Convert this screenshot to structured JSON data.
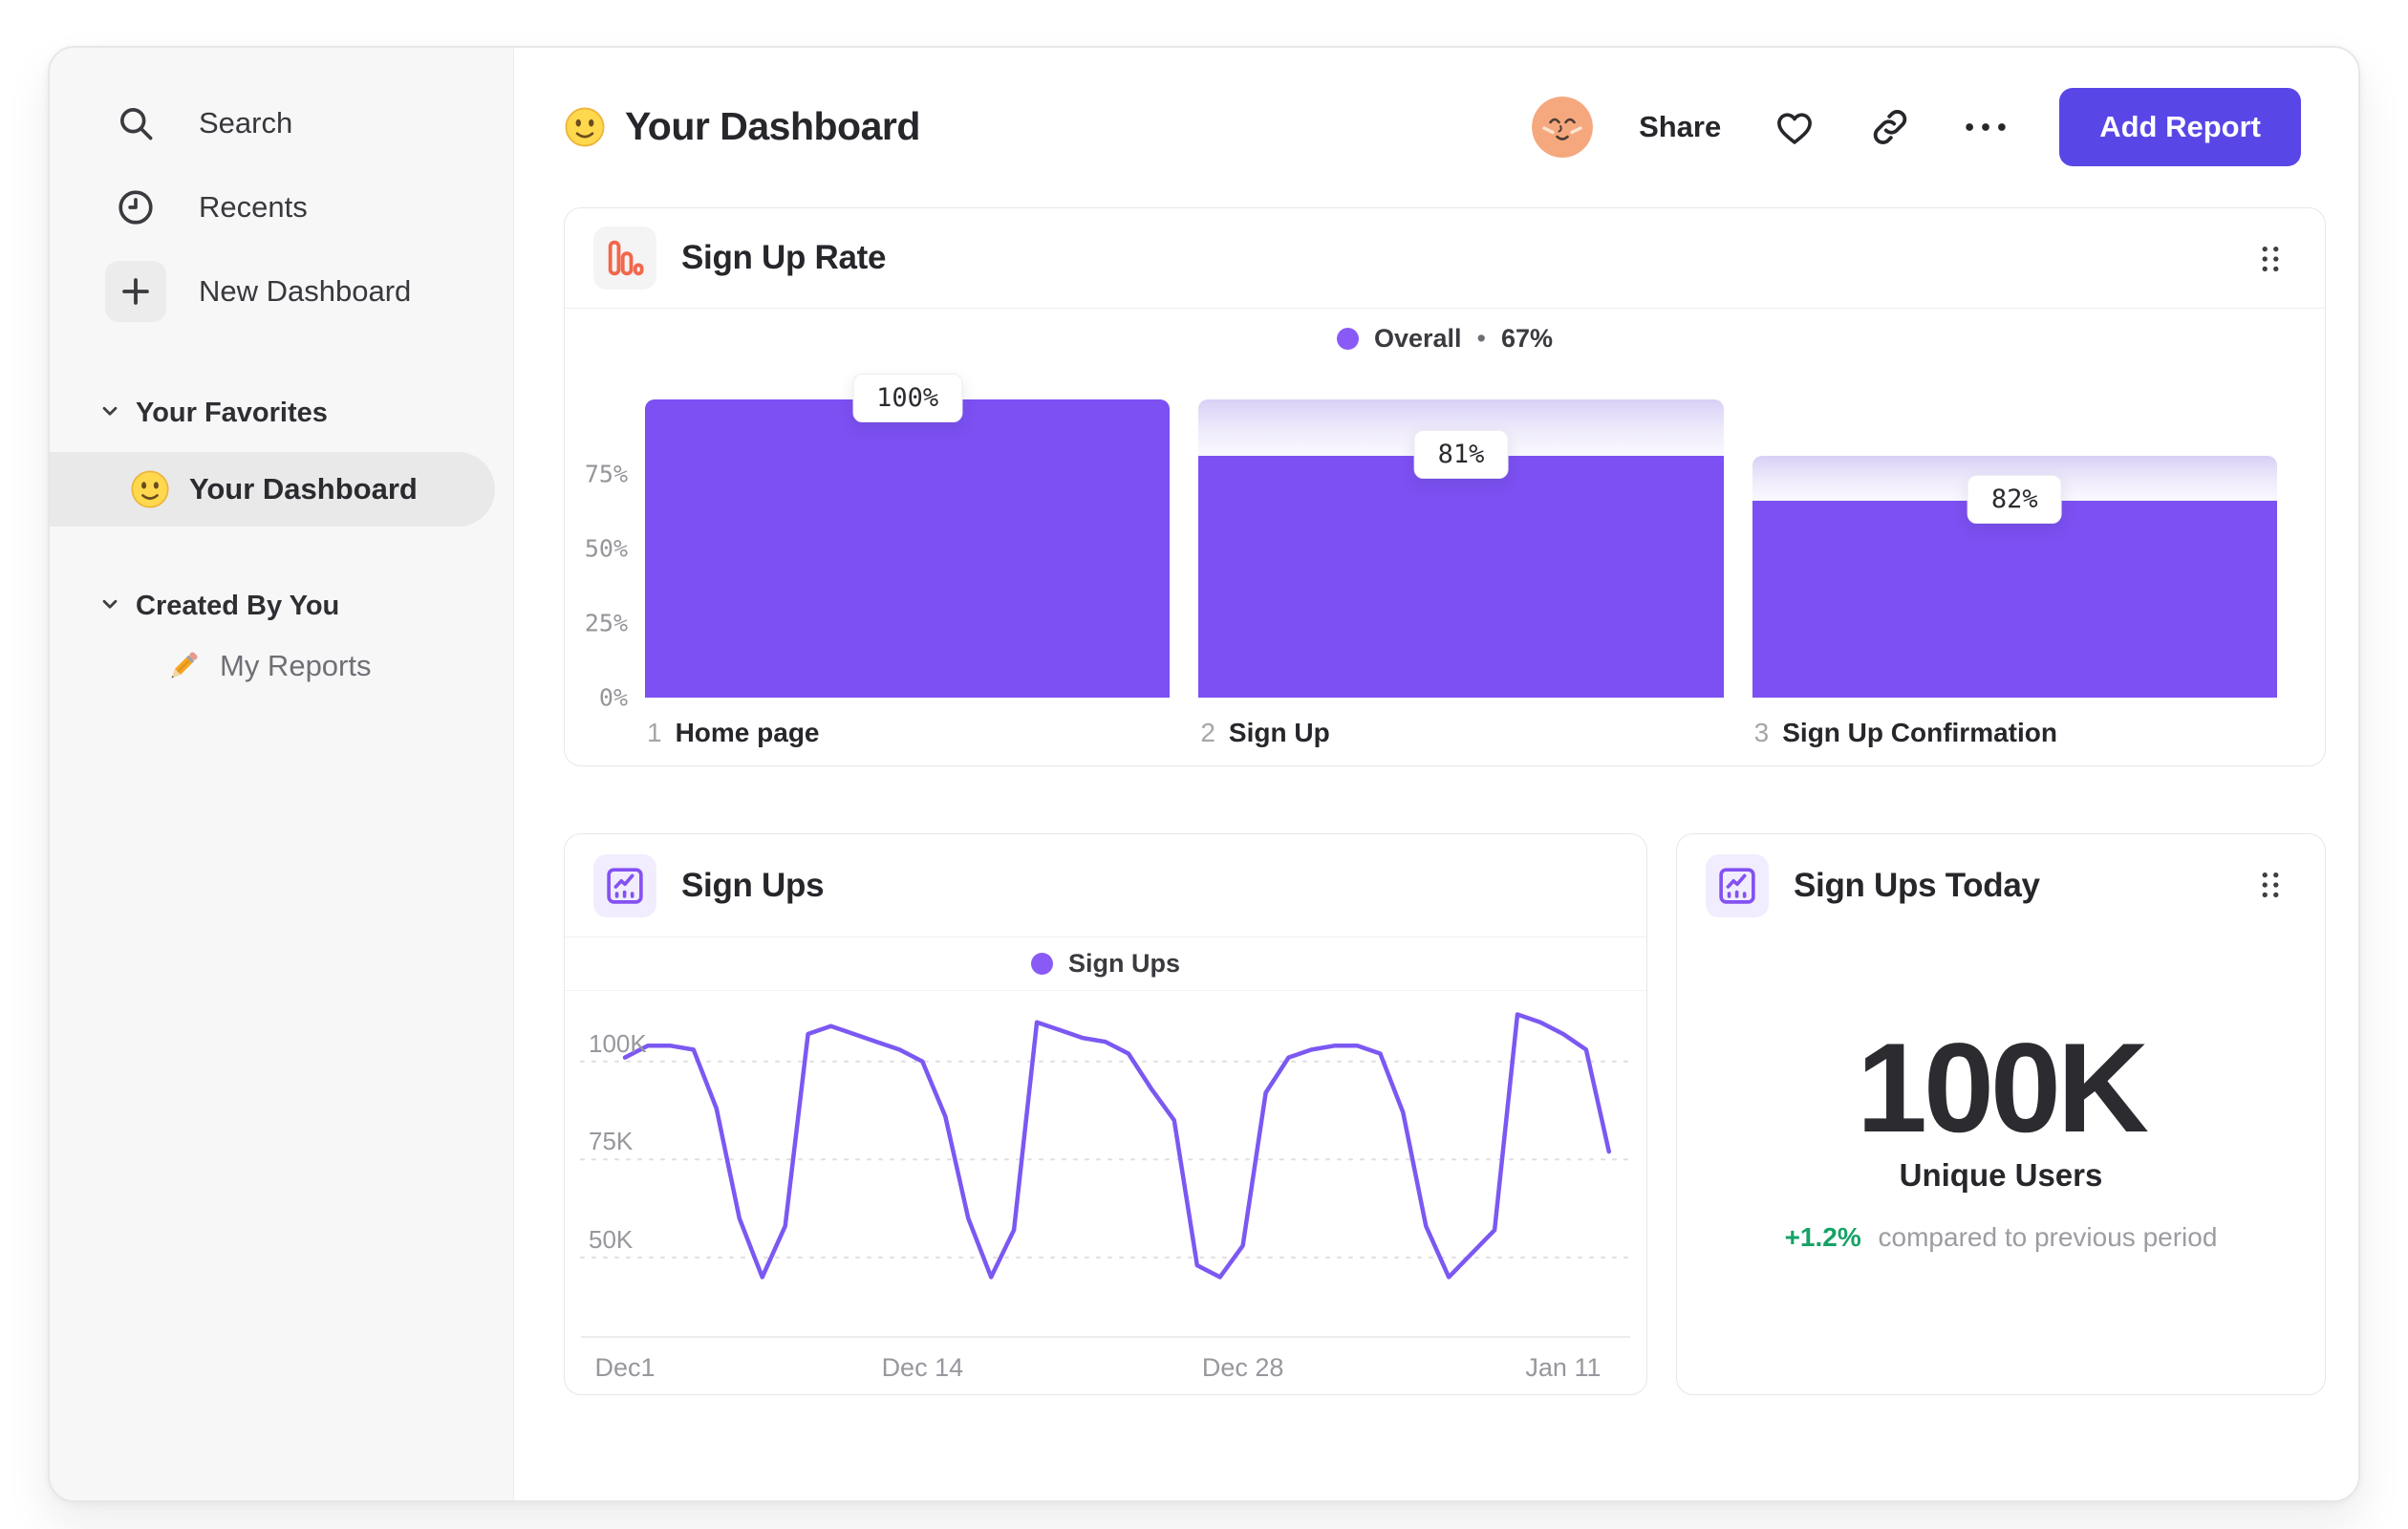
{
  "sidebar": {
    "nav": [
      {
        "label": "Search"
      },
      {
        "label": "Recents"
      },
      {
        "label": "New Dashboard"
      }
    ],
    "sections": [
      {
        "label": "Your Favorites"
      },
      {
        "label": "Created By You"
      }
    ],
    "favorites_item": {
      "label": "Your Dashboard"
    },
    "created_item": {
      "label": "My Reports"
    }
  },
  "header": {
    "title": "Your Dashboard",
    "share": "Share",
    "add_report": "Add Report"
  },
  "cards": {
    "funnel": {
      "title": "Sign Up Rate",
      "legend": {
        "label": "Overall",
        "sep": "•",
        "value": "67%"
      }
    },
    "line": {
      "title": "Sign Ups",
      "legend": {
        "label": "Sign Ups"
      }
    },
    "kpi": {
      "title": "Sign Ups Today",
      "value": "100K",
      "label": "Unique Users",
      "delta": "+1.2%",
      "delta_caption": "compared to previous period"
    }
  },
  "chart_data": [
    {
      "type": "bar",
      "subtype": "funnel",
      "title": "Sign Up Rate",
      "legend": "Overall",
      "overall_conversion": "67%",
      "step_numbers": [
        "1",
        "2",
        "3"
      ],
      "categories": [
        "Home page",
        "Sign Up",
        "Sign Up Confirmation"
      ],
      "values_pct_of_total": [
        100,
        81,
        66
      ],
      "step_conversion_labels": [
        "100%",
        "81%",
        "82%"
      ],
      "y_tick_labels": [
        "0%",
        "25%",
        "50%",
        "75%"
      ],
      "ylim": [
        0,
        100
      ],
      "bar_color": "#7C50F2"
    },
    {
      "type": "line",
      "title": "Sign Ups",
      "legend": "Sign Ups",
      "unit": "thousands of sign ups per day",
      "series": [
        {
          "name": "Sign Ups",
          "values": [
            101,
            104,
            104,
            103,
            88,
            60,
            45,
            58,
            107,
            109,
            107,
            105,
            103,
            100,
            86,
            60,
            45,
            57,
            110,
            108,
            106,
            105,
            102,
            93,
            85,
            48,
            45,
            53,
            92,
            101,
            103,
            104,
            104,
            102,
            87,
            58,
            45,
            51,
            57,
            112,
            110,
            107,
            103,
            77
          ]
        }
      ],
      "x_ticks": [
        {
          "label": "Dec1",
          "day": 0
        },
        {
          "label": "Dec 14",
          "day": 13
        },
        {
          "label": "Dec 28",
          "day": 27
        },
        {
          "label": "Jan 11",
          "day": 41
        }
      ],
      "y_ticks": [
        {
          "label": "100K",
          "value": 100
        },
        {
          "label": "75K",
          "value": 75
        },
        {
          "label": "50K",
          "value": 50
        }
      ],
      "y_range_displayed": [
        30,
        116.5
      ],
      "grid": "dashed horizontal",
      "legend_position": "top center",
      "line_color": "#7C58F2"
    },
    {
      "type": "kpi",
      "title": "Sign Ups Today",
      "value": "100K",
      "metric": "Unique Users",
      "change_pct": "+1.2%",
      "comparison": "compared to previous period"
    }
  ],
  "colors": {
    "accent_purple": "#7C50F2",
    "line_purple": "#7C58F2",
    "legend_dot": "#8A5AF7",
    "add_report_button": "#5847E6",
    "funnel_icon_orange": "#F2674A",
    "delta_green": "#17A266",
    "sidebar_bg": "#F7F7F8"
  }
}
